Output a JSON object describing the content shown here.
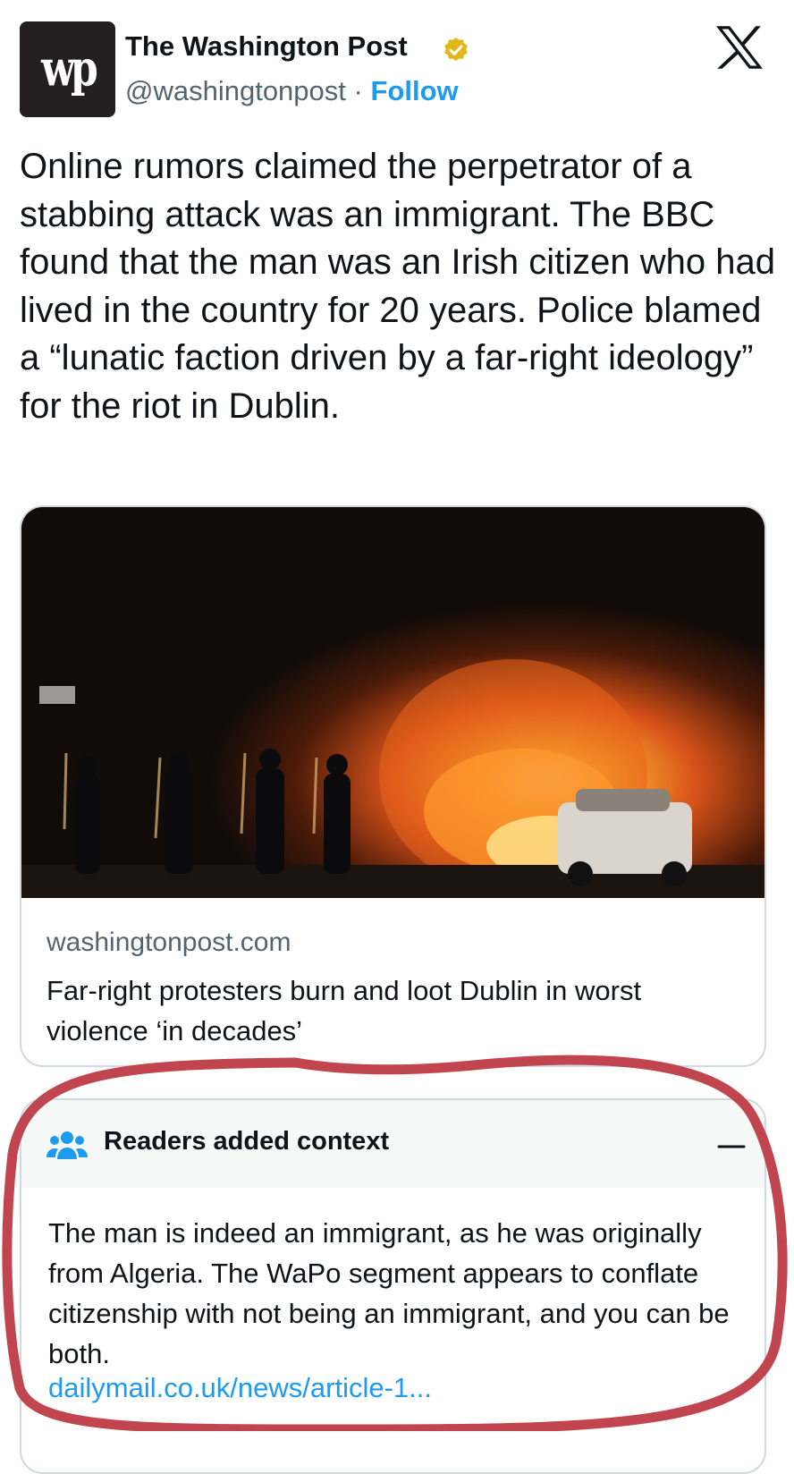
{
  "tweet": {
    "author": {
      "name": "The Washington Post",
      "handle": "@washingtonpost",
      "separator": "·",
      "follow_label": "Follow",
      "avatar_text": "wp",
      "verified": true
    },
    "text": "Online rumors claimed the perpetrator of a stabbing attack was an immigrant. The BBC found that the man was an Irish citizen who had lived in the country for 20 years. Police blamed a “lunatic faction driven by a far-right ideology” for the riot in Dublin."
  },
  "link_card": {
    "image_icon": "photo-riot-burning-car",
    "domain": "washingtonpost.com",
    "title": "Far-right protesters burn and loot Dublin in worst violence ‘in decades’"
  },
  "community_note": {
    "header": "Readers added context",
    "icon": "people-icon",
    "body": "The man is indeed an immigrant, as he was originally from Algeria. The WaPo segment appears to conflate citizenship with  not being an immigrant, and you can be both.",
    "link": "dailymail.co.uk/news/article-1..."
  },
  "colors": {
    "accent": "#1d9bf0",
    "text": "#0f1419",
    "secondary": "#536471",
    "verified_badge": "#e2b719",
    "annotation": "#c0454f"
  }
}
